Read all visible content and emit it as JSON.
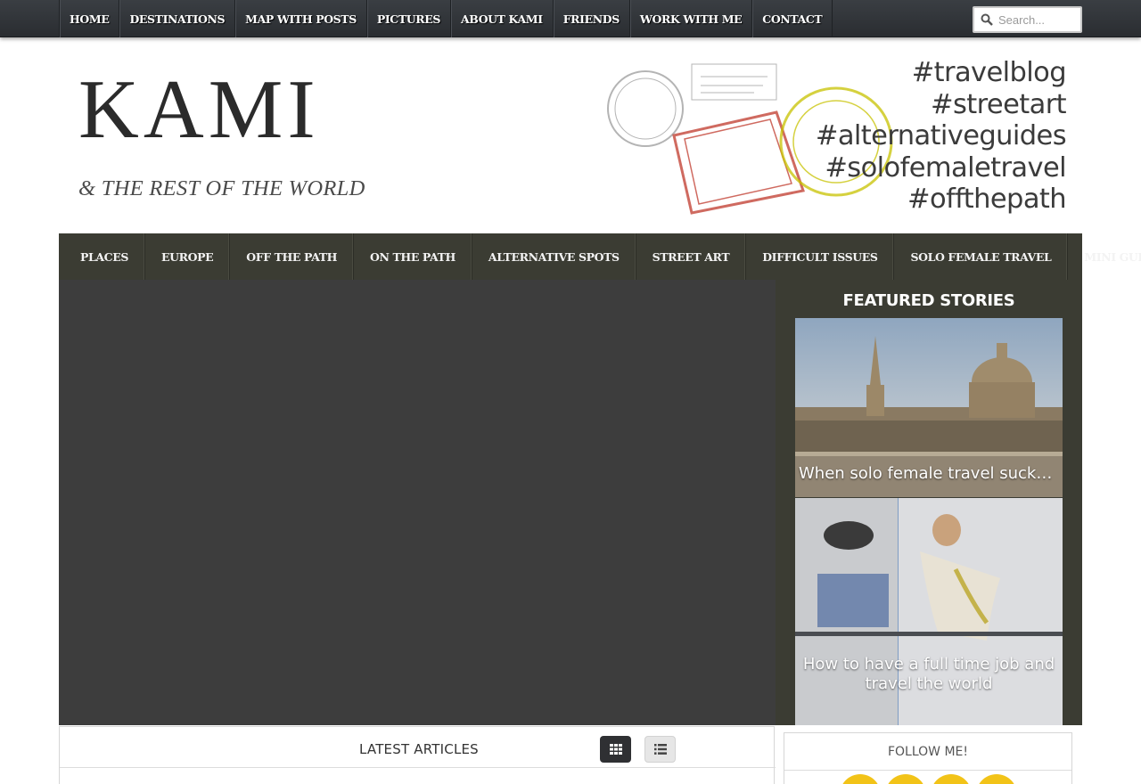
{
  "top_nav": {
    "items": [
      "HOME",
      "DESTINATIONS",
      "MAP WITH POSTS",
      "PICTURES",
      "ABOUT KAMI",
      "FRIENDS",
      "WORK WITH ME",
      "CONTACT"
    ]
  },
  "search": {
    "placeholder": "Search...",
    "icon": "magnifier-icon"
  },
  "header": {
    "logo_title": "KAMI",
    "logo_subtitle": "& THE REST OF THE WORLD",
    "hashtags": [
      "#travelblog",
      "#streetart",
      "#alternativeguides",
      "#solofemaletravel",
      "#offthepath"
    ]
  },
  "category_nav": {
    "items": [
      "PLACES",
      "EUROPE",
      "OFF THE PATH",
      "ON THE PATH",
      "ALTERNATIVE SPOTS",
      "STREET ART",
      "DIFFICULT ISSUES",
      "SOLO FEMALE TRAVEL",
      "MINI GUIDES"
    ]
  },
  "featured": {
    "heading": "FEATURED STORIES",
    "stories": [
      {
        "caption": "When solo female travel sucks..."
      },
      {
        "caption": "How to have a full time job and travel the world"
      }
    ]
  },
  "latest": {
    "title": "LATEST ARTICLES",
    "grid_icon": "grid-view-icon",
    "list_icon": "list-view-icon"
  },
  "follow": {
    "title": "FOLLOW ME!",
    "icons": [
      "facebook-icon",
      "twitter-icon",
      "email-icon",
      "rss-icon"
    ],
    "accent": "#f2c318"
  },
  "colors": {
    "topbar": "#2f3236",
    "category_bar": "#3b3c33",
    "slider_bg": "#3d3d3d"
  }
}
